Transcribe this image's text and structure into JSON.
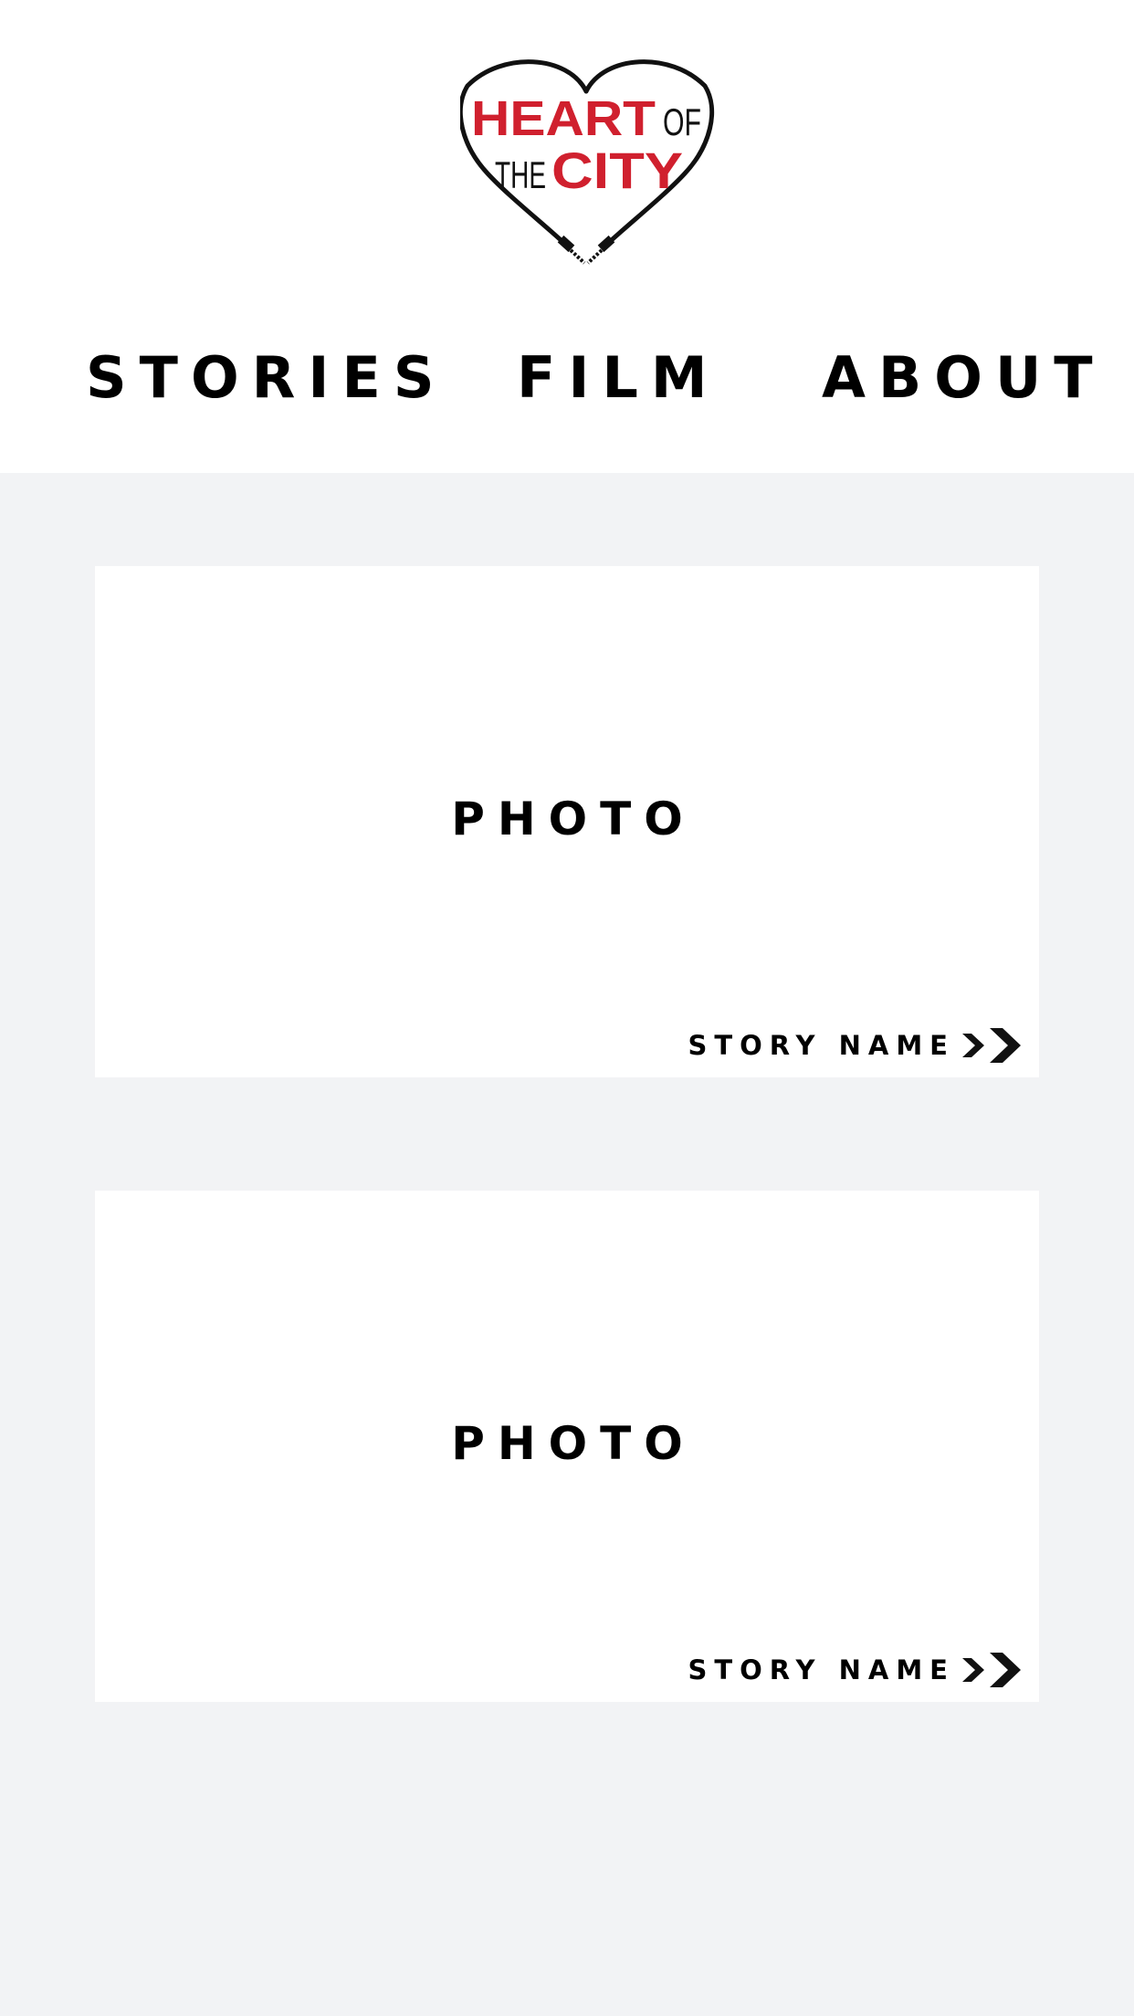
{
  "logo": {
    "line1_red": "HEART",
    "line1_black": "OF",
    "line2_black": "THE",
    "line2_red": "CITY",
    "brand_red": "#d0202e"
  },
  "nav": {
    "items": [
      {
        "label": "STORIES"
      },
      {
        "label": "FILM"
      },
      {
        "label": "ABOUT"
      }
    ]
  },
  "cards": [
    {
      "photo_label": "PHOTO",
      "story_name": "STORY NAME",
      "icon": "double-chevron-right-icon"
    },
    {
      "photo_label": "PHOTO",
      "story_name": "STORY NAME",
      "icon": "double-chevron-right-icon"
    }
  ],
  "colors": {
    "page_background": "#f2f3f5",
    "header_background": "#ffffff",
    "card_background": "#ffffff",
    "text": "#000000"
  }
}
